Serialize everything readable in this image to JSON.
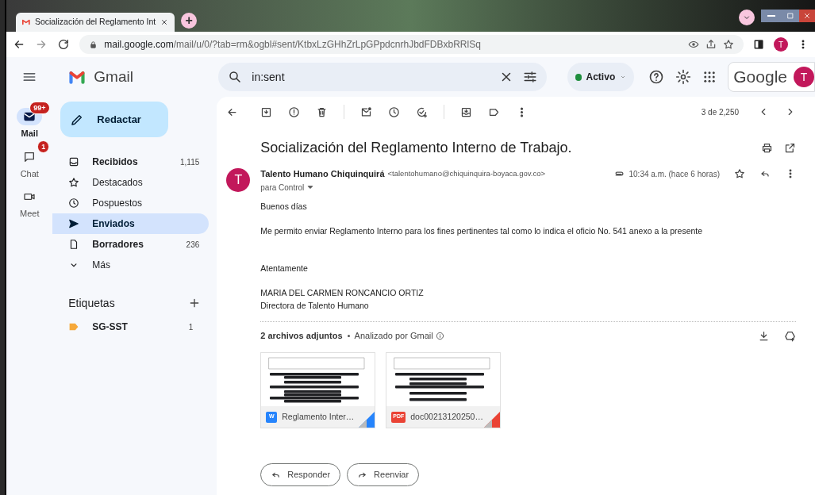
{
  "browser": {
    "tab": {
      "title": "Socialización del Reglamento Int",
      "selected": true
    },
    "new_tab": "+",
    "url": {
      "host": "mail.google.com",
      "path": "/mail/u/0/?tab=rm&ogbl#sent/KtbxLzGHhZrLpGPpdcnrhJbdFDBxbRRlSq"
    },
    "profile_initial": "T"
  },
  "app": {
    "name": "Gmail",
    "search": {
      "value": "in:sent"
    },
    "status": "Activo",
    "brand": "Google",
    "account_initial": "T"
  },
  "rail": [
    {
      "label": "Mail",
      "badge": "99+",
      "selected": true
    },
    {
      "label": "Chat",
      "badge": "1",
      "selected": false
    },
    {
      "label": "Meet",
      "selected": false
    }
  ],
  "compose": "Redactar",
  "folders": [
    {
      "kind": "inbox",
      "label": "Recibidos",
      "count": "1,115",
      "unread": true,
      "selected": false
    },
    {
      "kind": "star",
      "label": "Destacados",
      "unread": false,
      "selected": false
    },
    {
      "kind": "clock",
      "label": "Pospuestos",
      "unread": false,
      "selected": false
    },
    {
      "kind": "send",
      "label": "Enviados",
      "unread": true,
      "selected": true
    },
    {
      "kind": "draft",
      "label": "Borradores",
      "count": "236",
      "unread": true,
      "selected": false
    },
    {
      "kind": "more",
      "label": "Más",
      "unread": false,
      "selected": false
    }
  ],
  "labels_heading": "Etiquetas",
  "labels": [
    {
      "name": "SG-SST",
      "count": "1",
      "color": "#f6a93b"
    }
  ],
  "message": {
    "position": "3 de 2,250",
    "subject": "Socialización del Reglamento Interno de Trabajo.",
    "sender_initial": "T",
    "sender_name": "Talento Humano Chiquinquirá",
    "sender_email": "<talentohumano@chiquinquira-boyaca.gov.co>",
    "recipient": "para Control",
    "time": "10:34 a.m. (hace 6 horas)",
    "starred": false,
    "body": [
      [
        "Buenos días"
      ],
      [
        "Me permito enviar Reglamento Interno para los fines pertinentes tal como lo indica el oficio No. 541 anexo a la presente"
      ],
      [
        "Atentamente"
      ],
      [
        "MARIA DEL CARMEN RONCANCIO ORTIZ",
        "Directora de Talento Humano"
      ]
    ],
    "attachments_title": "2 archivos adjuntos",
    "scan_note": "Analizado por Gmail",
    "attachments": [
      {
        "kind": "word",
        "badge": "W",
        "name": "Reglamento Inter…",
        "color": "#2684fc"
      },
      {
        "kind": "pdf",
        "badge": "PDF",
        "name": "doc00213120250…",
        "color": "#ea4335"
      }
    ]
  },
  "actions": [
    {
      "kind": "reply",
      "label": "Responder"
    },
    {
      "kind": "forward",
      "label": "Reenviar"
    }
  ]
}
